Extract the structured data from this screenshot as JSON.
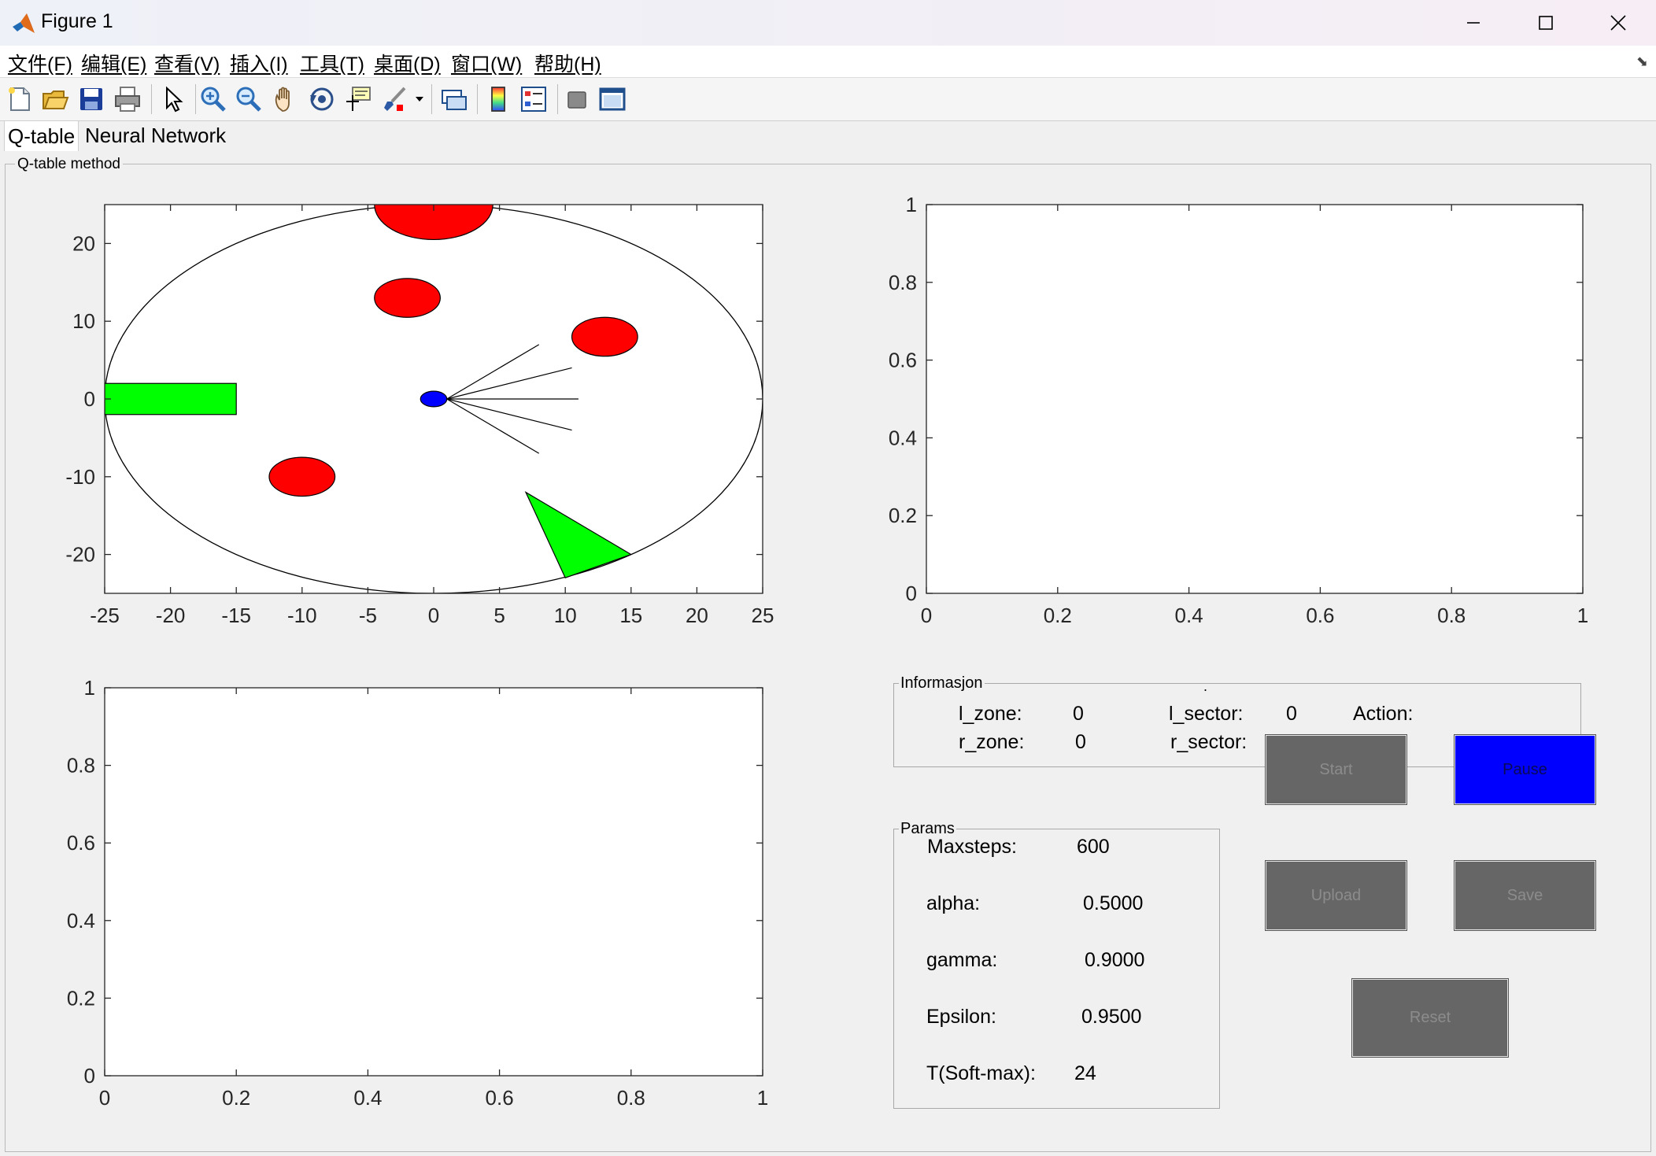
{
  "window": {
    "title": "Figure 1"
  },
  "menu": [
    "文件(F)",
    "编辑(E)",
    "查看(V)",
    "插入(I)",
    "工具(T)",
    "桌面(D)",
    "窗口(W)",
    "帮助(H)"
  ],
  "toolbar": [
    "new-figure-icon",
    "open-icon",
    "save-icon",
    "print-icon",
    "select-arrow-icon",
    "zoom-in-icon",
    "zoom-out-icon",
    "pan-hand-icon",
    "rotate-3d-icon",
    "data-cursor-icon",
    "brush-icon",
    "link-plot-icon",
    "colorbar-icon",
    "legend-icon",
    "hide-plot-tools-icon",
    "show-plot-tools-icon"
  ],
  "tabs": {
    "qtable": "Q-table",
    "nn": "Neural Network"
  },
  "panel": {
    "title": "Q-table method"
  },
  "plots": {
    "env": {
      "xticks": [
        "-25",
        "-20",
        "-15",
        "-10",
        "-5",
        "0",
        "5",
        "10",
        "15",
        "20",
        "25"
      ],
      "yticks": [
        "20",
        "10",
        "0",
        "-10",
        "-20"
      ]
    },
    "top_right": {
      "xticks": [
        "0",
        "0.2",
        "0.4",
        "0.6",
        "0.8",
        "1"
      ],
      "yticks": [
        "1",
        "0.8",
        "0.6",
        "0.4",
        "0.2",
        "0"
      ]
    },
    "bottom_left": {
      "xticks": [
        "0",
        "0.2",
        "0.4",
        "0.6",
        "0.8",
        "1"
      ],
      "yticks": [
        "1",
        "0.8",
        "0.6",
        "0.4",
        "0.2",
        "0"
      ]
    }
  },
  "chart_data": [
    {
      "type": "scatter",
      "xlim": [
        -25,
        25
      ],
      "ylim": [
        -25,
        25
      ],
      "arena": {
        "cx": 0,
        "cy": 0,
        "r": 25
      },
      "obstacles": [
        {
          "cx": 0,
          "cy": 25,
          "r": 4.5
        },
        {
          "cx": -2,
          "cy": 13,
          "r": 2.5
        },
        {
          "cx": 13,
          "cy": 8,
          "r": 2.5
        },
        {
          "cx": -10,
          "cy": -10,
          "r": 2.5
        }
      ],
      "goal_rect": {
        "x0": -25,
        "y0": -2,
        "x1": -15,
        "y1": 2
      },
      "goal_triangle": [
        [
          7,
          -12
        ],
        [
          15,
          -20
        ],
        [
          10,
          -23
        ]
      ],
      "agent": {
        "cx": 0,
        "cy": 0,
        "r": 1
      },
      "sensor_rays": [
        [
          8,
          7
        ],
        [
          10.5,
          4
        ],
        [
          11,
          0
        ],
        [
          10.5,
          -4
        ],
        [
          8,
          -7
        ]
      ]
    },
    {
      "type": "line",
      "xlim": [
        0,
        1
      ],
      "ylim": [
        0,
        1
      ]
    },
    {
      "type": "line",
      "xlim": [
        0,
        1
      ],
      "ylim": [
        0,
        1
      ]
    }
  ],
  "info": {
    "title": "Informasjon",
    "dot": ".",
    "l_zone_label": "l_zone:",
    "l_zone_value": "0",
    "l_sector_label": "l_sector:",
    "l_sector_value": "0",
    "action_label": "Action:",
    "r_zone_label": "r_zone:",
    "r_zone_value": "0",
    "r_sector_label": "r_sector:"
  },
  "params": {
    "title": "Params",
    "maxsteps_label": "Maxsteps:",
    "maxsteps_value": "600",
    "alpha_label": "alpha:",
    "alpha_value": "0.5000",
    "gamma_label": "gamma:",
    "gamma_value": "0.9000",
    "epsilon_label": "Epsilon:",
    "epsilon_value": "0.9500",
    "t_label": "T(Soft-max):",
    "t_value": "24"
  },
  "buttons": {
    "start": "Start",
    "pause": "Pause",
    "upload": "Upload",
    "save": "Save",
    "reset": "Reset"
  },
  "colors": {
    "obstacle": "#ff0000",
    "goal": "#00ff00",
    "agent": "#0000ff",
    "pause_button": "#0000ff",
    "button": "#666666"
  }
}
